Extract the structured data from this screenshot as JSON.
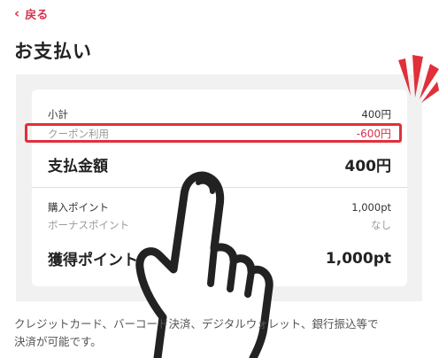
{
  "header": {
    "back_icon": "chevron-left-icon",
    "back_label": "戻る",
    "title": "お支払い"
  },
  "summary": {
    "subtotal_label": "小計",
    "subtotal_value": "400円",
    "coupon_label": "クーポン利用",
    "coupon_value": "-600円",
    "total_label": "支払金額",
    "total_value": "400円",
    "purchase_points_label": "購入ポイント",
    "purchase_points_value": "1,000pt",
    "bonus_points_label": "ボーナスポイント",
    "bonus_points_value": "なし",
    "earned_points_label": "獲得ポイント",
    "earned_points_value": "1,000pt"
  },
  "footer": {
    "description_line1": "クレジットカード、バーコード決済、デジタルウォレット、銀行振込等で",
    "description_line2": "決済が可能です。"
  },
  "colors": {
    "accent": "#d4334e",
    "highlight": "#e0303a",
    "panel": "#f1f1f1"
  }
}
